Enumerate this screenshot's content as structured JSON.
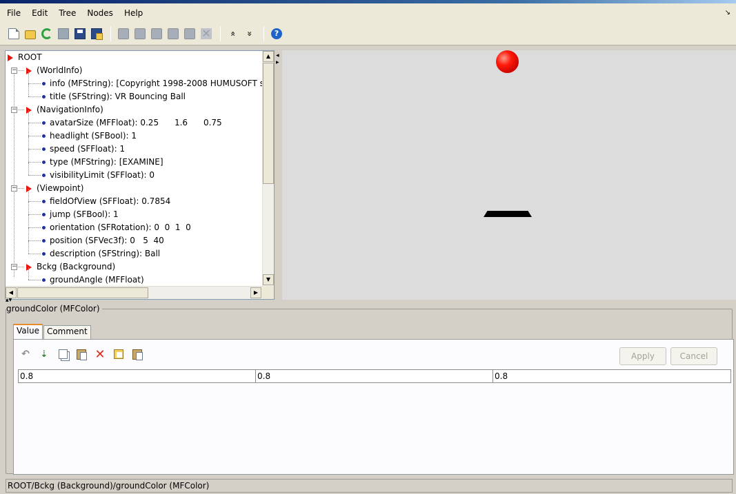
{
  "menubar": {
    "items": [
      "File",
      "Edit",
      "Tree",
      "Nodes",
      "Help"
    ],
    "corner_glyph": "↘"
  },
  "toolbar": {
    "icons": [
      "new-file-icon",
      "open-folder-icon",
      "reload-icon",
      "save-disabled-icon",
      "save-icon",
      "save-as-icon",
      "undo-disabled-icon",
      "copy-disabled-icon",
      "cut-disabled-icon",
      "paste-disabled-icon",
      "paste-special-disabled-icon",
      "delete-disabled-icon",
      "collapse-all-icon",
      "expand-all-icon",
      "help-icon"
    ],
    "collapse_glyph": "«",
    "expand_glyph": "»",
    "help_glyph": "?"
  },
  "tree": {
    "rows": [
      {
        "kind": "node",
        "level": 0,
        "text": "ROOT"
      },
      {
        "kind": "node",
        "level": 1,
        "text": "(WorldInfo)"
      },
      {
        "kind": "field",
        "level": 2,
        "text": "info (MFString): [Copyright 1998-2008 HUMUSOFT s"
      },
      {
        "kind": "field",
        "level": 2,
        "text": "title (SFString): VR Bouncing Ball"
      },
      {
        "kind": "node",
        "level": 1,
        "text": "(NavigationInfo)"
      },
      {
        "kind": "field",
        "level": 2,
        "text": "avatarSize (MFFloat): 0.25      1.6      0.75"
      },
      {
        "kind": "field",
        "level": 2,
        "text": "headlight (SFBool): 1"
      },
      {
        "kind": "field",
        "level": 2,
        "text": "speed (SFFloat): 1"
      },
      {
        "kind": "field",
        "level": 2,
        "text": "type (MFString): [EXAMINE]"
      },
      {
        "kind": "field",
        "level": 2,
        "text": "visibilityLimit (SFFloat): 0"
      },
      {
        "kind": "node",
        "level": 1,
        "text": "(Viewpoint)"
      },
      {
        "kind": "field",
        "level": 2,
        "text": "fieldOfView (SFFloat): 0.7854"
      },
      {
        "kind": "field",
        "level": 2,
        "text": "jump (SFBool): 1"
      },
      {
        "kind": "field",
        "level": 2,
        "text": "orientation (SFRotation): 0  0  1  0"
      },
      {
        "kind": "field",
        "level": 2,
        "text": "position (SFVec3f): 0   5  40"
      },
      {
        "kind": "field",
        "level": 2,
        "text": "description (SFString): Ball"
      },
      {
        "kind": "node",
        "level": 1,
        "text": "Bckg (Background)"
      },
      {
        "kind": "field",
        "level": 2,
        "text": "groundAngle (MFFloat)"
      }
    ],
    "expander_glyph": "−"
  },
  "scroll": {
    "up": "▲",
    "down": "▼",
    "left": "◀",
    "right": "▶"
  },
  "editor": {
    "group_label": "groundColor (MFColor)",
    "tabs": [
      {
        "label": "Value",
        "active": true
      },
      {
        "label": "Comment",
        "active": false
      }
    ],
    "tools": {
      "undo": "↶",
      "add": "⇣",
      "delete": "✕"
    },
    "apply_label": "Apply",
    "cancel_label": "Cancel",
    "values": [
      "0.8",
      "0.8",
      "0.8"
    ]
  },
  "status": {
    "path": "ROOT/Bckg (Background)/groundColor (MFColor)"
  },
  "colors": {
    "node_marker": "#e8160c",
    "field_bullet": "#1e2fa8",
    "ball": "#ff1a0a",
    "paddle": "#000000",
    "viewer_bg": "#dcdcdc"
  }
}
